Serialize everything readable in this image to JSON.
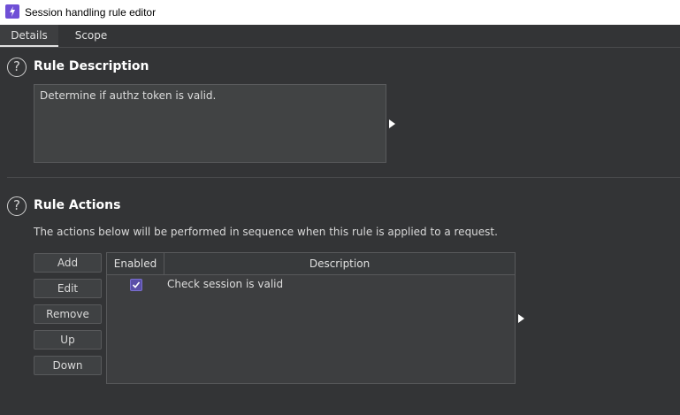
{
  "window": {
    "title": "Session handling rule editor",
    "icon": "lightning-icon"
  },
  "tabs": [
    {
      "label": "Details"
    },
    {
      "label": "Scope"
    }
  ],
  "rule_description": {
    "heading": "Rule Description",
    "text": "Determine if authz token is valid."
  },
  "rule_actions": {
    "heading": "Rule Actions",
    "intro": "The actions below will be performed in sequence when this rule is applied to a request.",
    "buttons": {
      "add": "Add",
      "edit": "Edit",
      "remove": "Remove",
      "up": "Up",
      "down": "Down"
    },
    "table": {
      "columns": [
        "Enabled",
        "Description"
      ],
      "rows": [
        {
          "enabled": true,
          "description": "Check session is valid"
        }
      ]
    }
  },
  "colors": {
    "accent": "#6f4fd6",
    "background": "#333436"
  }
}
